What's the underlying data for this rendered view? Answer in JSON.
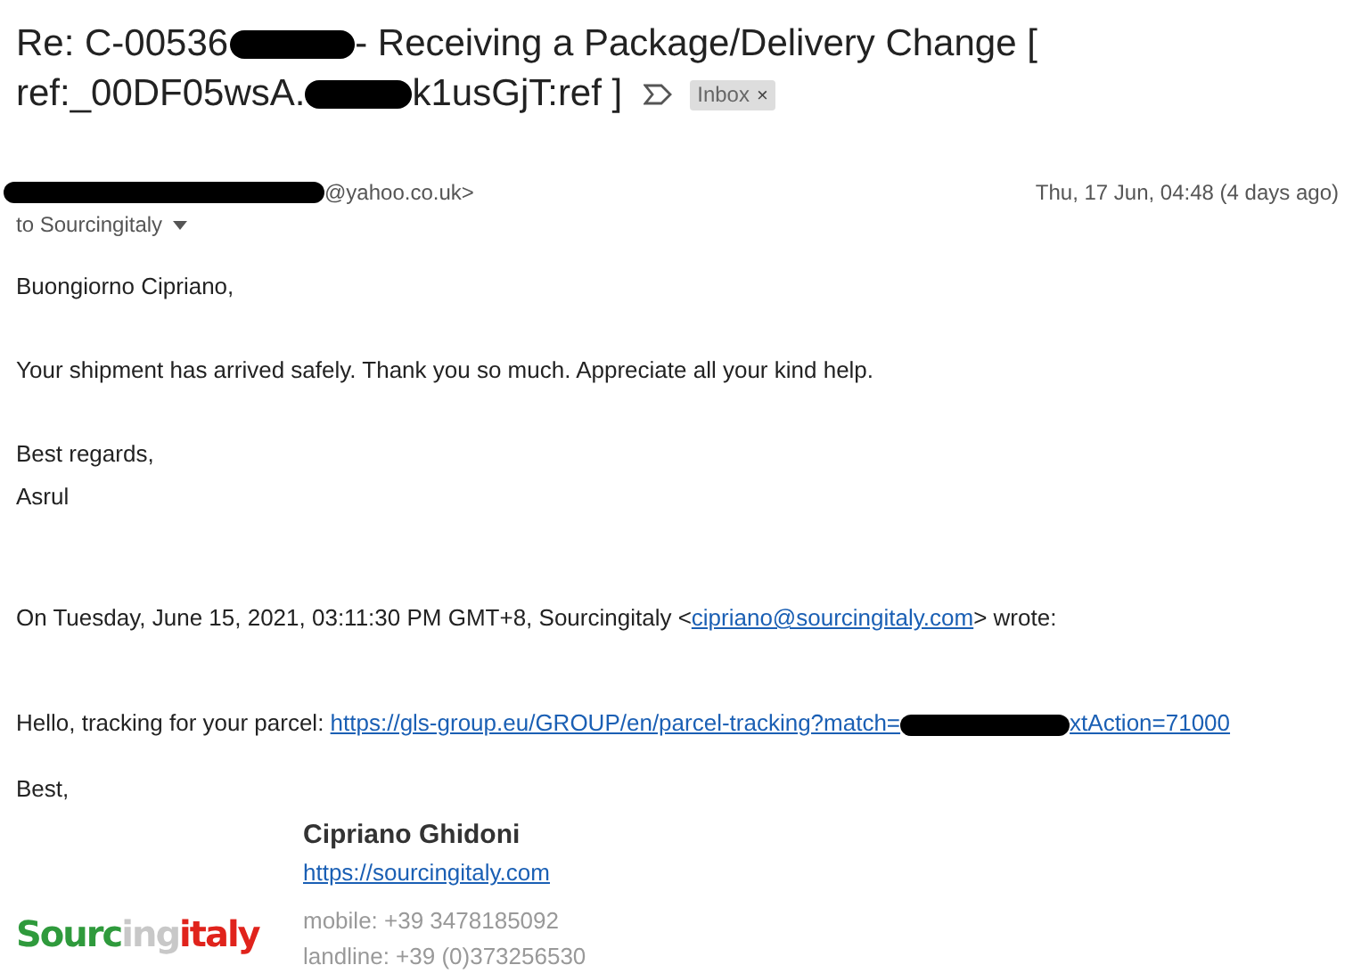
{
  "subject": {
    "line_1_before": "Re: C-00536",
    "line_1_after": "- Receiving a Package/Delivery Change [",
    "line_2_before": "ref:_00DF05wsA.",
    "line_2_after": "k1usGjT:ref ]",
    "label": "Inbox",
    "label_close": "×"
  },
  "sender": {
    "address_tail": "@yahoo.co.uk>",
    "date": "Thu, 17 Jun, 04:48 (4 days ago)",
    "recipient": "to Sourcingitaly"
  },
  "body": [
    "Buongiorno Cipriano,",
    "Your shipment has arrived safely. Thank you so much. Appreciate all your kind help.",
    "Best regards,",
    "Asrul"
  ],
  "quote": {
    "header_before": "On Tuesday, June 15, 2021, 03:11:30 PM GMT+8, Sourcingitaly <",
    "header_link": "cipriano@sourcingitaly.com",
    "header_after": "> wrote:",
    "tracking_text": "Hello, tracking for your parcel: ",
    "tracking_link_before": "https://gls-group.eu/GROUP/en/parcel-tracking?match=",
    "tracking_link_after": "xtAction=71000",
    "closing": "Best,"
  },
  "signature": {
    "name": "Cipriano Ghidoni",
    "website": "https://sourcingitaly.com",
    "mobile": "mobile: +39 3478185092",
    "landline": "landline: +39 (0)373256530",
    "logo": [
      {
        "text": "Sourc",
        "color": "#2f9a3c"
      },
      {
        "text": "ing",
        "color": "#c8c8c8"
      },
      {
        "text": "italy",
        "color": "#e0231c"
      }
    ]
  }
}
